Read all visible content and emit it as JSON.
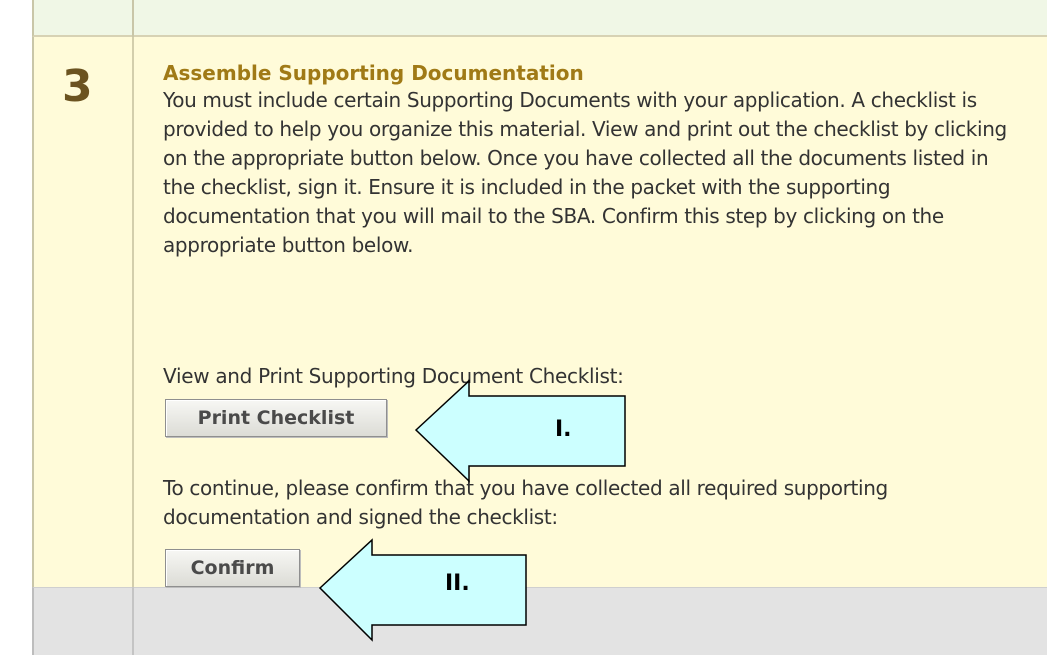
{
  "step": {
    "number": "3",
    "title": "Assemble Supporting Documentation",
    "description": "You must include certain Supporting Documents with your application. A checklist is provided to help you organize this material. View and print out the checklist by clicking on the appropriate button below. Once you have collected all the documents listed in the checklist, sign it. Ensure it is included in the packet with the supporting documentation that you will mail to the SBA. Confirm this step by clicking on the appropriate button below.",
    "view_label": "View and Print Supporting Document Checklist:",
    "print_button_label": "Print Checklist",
    "continue_text": "To continue, please confirm that you have collected all required supporting documentation and signed the checklist:",
    "confirm_button_label": "Confirm"
  },
  "callouts": [
    {
      "label": "I.",
      "fill_color": "#ccffff"
    },
    {
      "label": "II.",
      "fill_color": "#ccffff"
    }
  ],
  "colors": {
    "step_background": "#fffbd9",
    "title_color": "#a07a16",
    "number_color": "#6b5320",
    "text_color": "#333333"
  }
}
